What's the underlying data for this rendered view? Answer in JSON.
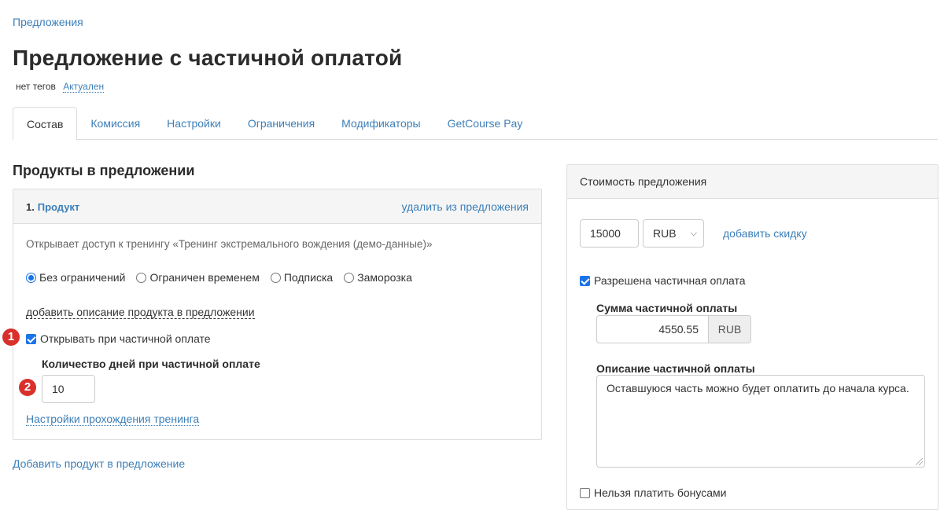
{
  "breadcrumb": "Предложения",
  "title": "Предложение с частичной оплатой",
  "meta": {
    "tags": "нет тегов",
    "status": "Актуален"
  },
  "tabs": [
    {
      "label": "Состав"
    },
    {
      "label": "Комиссия"
    },
    {
      "label": "Настройки"
    },
    {
      "label": "Ограничения"
    },
    {
      "label": "Модификаторы"
    },
    {
      "label": "GetCourse Pay"
    }
  ],
  "products": {
    "section_title": "Продукты в предложении",
    "item": {
      "number": "1.",
      "name": "Продукт",
      "remove": "удалить из предложения",
      "description": "Открывает доступ к тренингу «Тренинг экстремального вождения (демо-данные)»",
      "radios": [
        {
          "label": "Без ограничений",
          "checked": true
        },
        {
          "label": "Ограничен временем",
          "checked": false
        },
        {
          "label": "Подписка",
          "checked": false
        },
        {
          "label": "Заморозка",
          "checked": false
        }
      ],
      "add_description": "добавить описание продукта в предложении",
      "open_on_partial": {
        "label": "Открывать при частичной оплате",
        "checked": true
      },
      "days_label": "Количество дней при частичной оплате",
      "days_value": "10",
      "training_settings": "Настройки прохождения тренинга"
    },
    "add_product": "Добавить продукт в предложение"
  },
  "cost": {
    "title": "Стоимость предложения",
    "price": "15000",
    "currency": "RUB",
    "add_discount": "добавить скидку",
    "partial_allowed": {
      "label": "Разрешена частичная оплата",
      "checked": true
    },
    "partial_sum_label": "Сумма частичной оплаты",
    "partial_sum": "4550.55",
    "partial_currency": "RUB",
    "partial_desc_label": "Описание частичной оплаты",
    "partial_desc": "Оставшуюся часть можно будет оплатить до начала курса.",
    "no_bonus": {
      "label": "Нельзя платить бонусами",
      "checked": false
    }
  },
  "badges": [
    "1",
    "2"
  ],
  "colors": {
    "link": "#3d7fb8",
    "badge": "#d9302c",
    "checkbox": "#1a73e8"
  }
}
